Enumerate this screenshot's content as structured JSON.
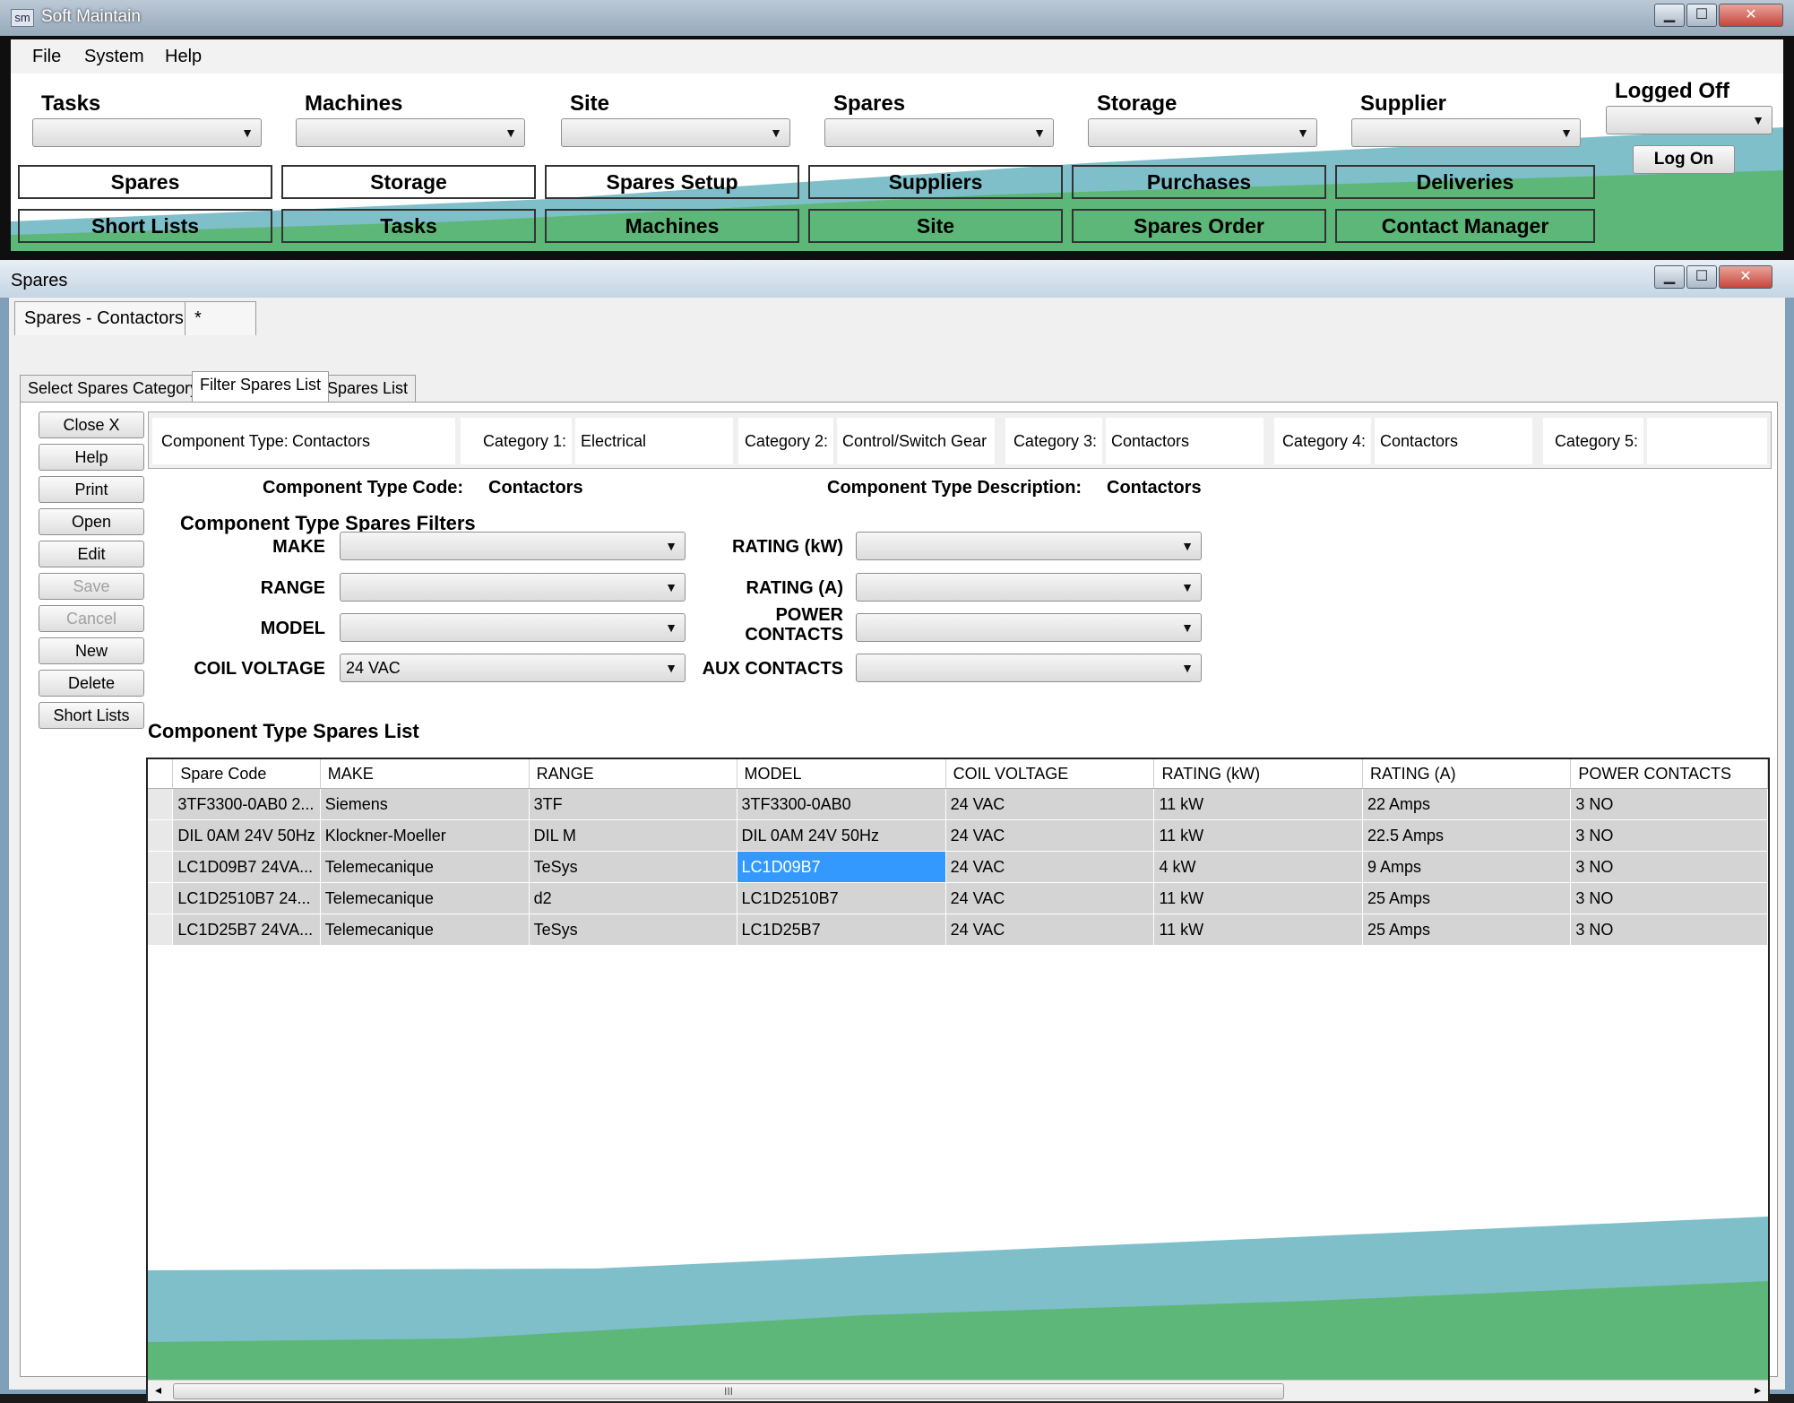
{
  "app": {
    "icon_text": "sm",
    "title": "Soft Maintain"
  },
  "window_controls": {
    "minimize": "▁",
    "maximize": "☐",
    "close": "✕"
  },
  "menu": [
    "File",
    "System",
    "Help"
  ],
  "toolbar": {
    "dropdown_labels": [
      "Tasks",
      "Machines",
      "Site",
      "Spares",
      "Storage",
      "Supplier"
    ],
    "login_status": "Logged Off",
    "login_button": "Log On",
    "row1_buttons": [
      "Spares",
      "Storage",
      "Spares Setup",
      "Suppliers",
      "Purchases",
      "Deliveries"
    ],
    "row2_buttons": [
      "Short Lists",
      "Tasks",
      "Machines",
      "Site",
      "Spares Order",
      "Contact Manager"
    ]
  },
  "child": {
    "caption": "Spares",
    "doc_tabs": [
      "Spares - Contactors",
      "*"
    ],
    "sub_tabs": [
      "Select Spares Category",
      "Filter Spares List",
      "Spares List"
    ],
    "active_sub_tab": "Filter Spares List",
    "side_buttons": [
      {
        "label": "Close X",
        "enabled": true
      },
      {
        "label": "Help",
        "enabled": true
      },
      {
        "label": "Print",
        "enabled": true
      },
      {
        "label": "Open",
        "enabled": true
      },
      {
        "label": "Edit",
        "enabled": true
      },
      {
        "label": "Save",
        "enabled": false
      },
      {
        "label": "Cancel",
        "enabled": false
      },
      {
        "label": "New",
        "enabled": true
      },
      {
        "label": "Delete",
        "enabled": true
      },
      {
        "label": "Short Lists",
        "enabled": true
      }
    ],
    "categories": [
      {
        "label": "Component Type:",
        "value": "Contactors"
      },
      {
        "label": "Category 1:",
        "value": "Electrical"
      },
      {
        "label": "Category 2:",
        "value": "Control/Switch Gear"
      },
      {
        "label": "Category 3:",
        "value": "Contactors"
      },
      {
        "label": "Category 4:",
        "value": "Contactors"
      },
      {
        "label": "Category 5:",
        "value": ""
      }
    ],
    "type_code_label": "Component Type Code:",
    "type_code_value": "Contactors",
    "type_desc_label": "Component Type Description:",
    "type_desc_value": "Contactors",
    "filters_title": "Component Type Spares Filters",
    "filters": {
      "make": {
        "label": "MAKE",
        "value": ""
      },
      "range": {
        "label": "RANGE",
        "value": ""
      },
      "model": {
        "label": "MODEL",
        "value": ""
      },
      "coil_voltage": {
        "label": "COIL VOLTAGE",
        "value": "24 VAC"
      },
      "rating_kw": {
        "label": "RATING (kW)",
        "value": ""
      },
      "rating_a": {
        "label": "RATING (A)",
        "value": ""
      },
      "power_contacts": {
        "label_line1": "POWER",
        "label_line2": "CONTACTS",
        "value": ""
      },
      "aux_contacts": {
        "label": "AUX CONTACTS",
        "value": ""
      }
    },
    "list_title": "Component Type Spares List",
    "grid": {
      "columns": [
        "Spare Code",
        "MAKE",
        "RANGE",
        "MODEL",
        "COIL VOLTAGE",
        "RATING (kW)",
        "RATING (A)",
        "POWER CONTACTS"
      ],
      "rows": [
        [
          "3TF3300-0AB0 2...",
          "Siemens",
          "3TF",
          "3TF3300-0AB0",
          "24 VAC",
          "11 kW",
          "22 Amps",
          "3 NO"
        ],
        [
          "DIL 0AM 24V 50Hz",
          "Klockner-Moeller",
          "DIL M",
          "DIL 0AM 24V 50Hz",
          "24 VAC",
          "11 kW",
          "22.5 Amps",
          "3 NO"
        ],
        [
          "LC1D09B7 24VA...",
          "Telemecanique",
          "TeSys",
          "LC1D09B7",
          "24 VAC",
          "4 kW",
          "9 Amps",
          "3 NO"
        ],
        [
          "LC1D2510B7 24...",
          "Telemecanique",
          "d2",
          "LC1D2510B7",
          "24 VAC",
          "11 kW",
          "25 Amps",
          "3 NO"
        ],
        [
          "LC1D25B7 24VA...",
          "Telemecanique",
          "TeSys",
          "LC1D25B7",
          "24 VAC",
          "11 kW",
          "25 Amps",
          "3 NO"
        ]
      ],
      "selected_cell": {
        "row": 2,
        "col": 3
      }
    },
    "scroll": {
      "left": "◂",
      "right": "▸",
      "grip": "III"
    }
  },
  "colors": {
    "teal": "#7fbfca",
    "green": "#5db778",
    "selection": "#3399ff"
  }
}
